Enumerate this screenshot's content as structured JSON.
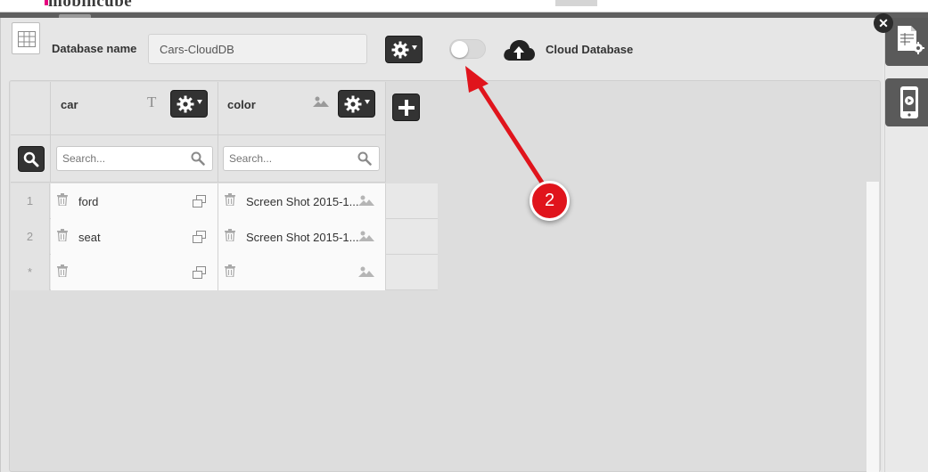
{
  "brand": {
    "name": "mobincube"
  },
  "header": {
    "db_name_label": "Database name",
    "db_name_value": "Cars-CloudDB",
    "cloud_label": "Cloud Database",
    "cloud_enabled": false
  },
  "table": {
    "columns": [
      {
        "name": "car",
        "type_icon": "text-type-icon"
      },
      {
        "name": "color",
        "type_icon": "image-type-icon"
      }
    ],
    "search_placeholder": "Search...",
    "rows": [
      {
        "num": "1",
        "car": "ford",
        "color": "Screen Shot 2015-1..."
      },
      {
        "num": "2",
        "car": "seat",
        "color": "Screen Shot 2015-1..."
      },
      {
        "num": "*",
        "car": "",
        "color": ""
      }
    ]
  },
  "annotation": {
    "badge": "2"
  },
  "colors": {
    "accent_dark": "#333333",
    "badge_red": "#e0141c",
    "brand_magenta": "#e6007e"
  }
}
